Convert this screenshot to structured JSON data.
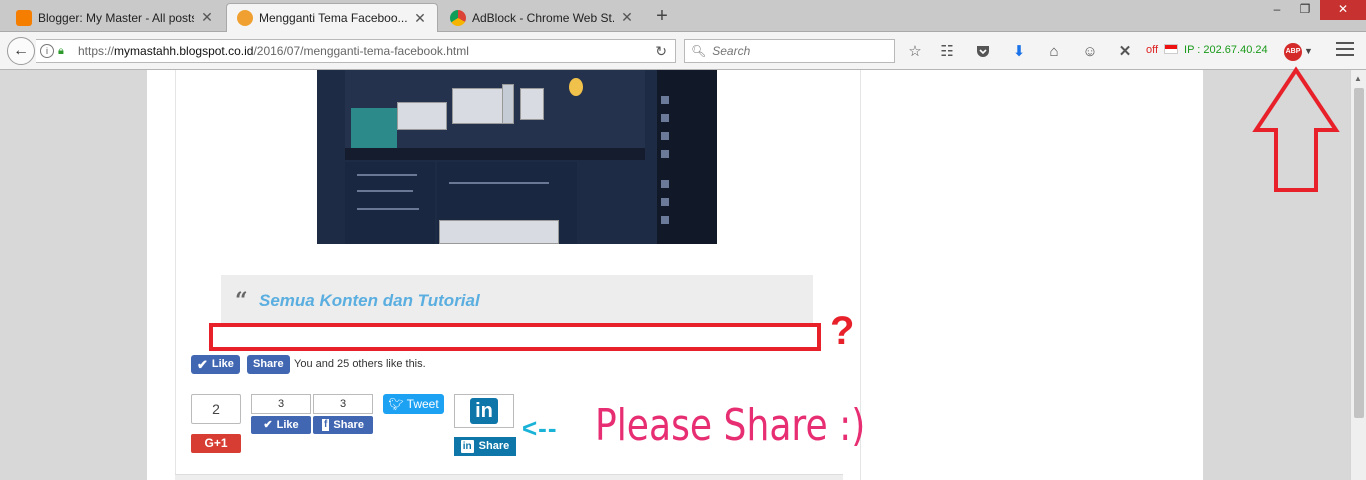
{
  "tabs": [
    {
      "title": "Blogger: My Master - All posts",
      "favicon_color": "#f57d00",
      "active": false
    },
    {
      "title": "Mengganti Tema Faceboo...",
      "favicon_color": "#f0a030",
      "active": true
    },
    {
      "title": "AdBlock - Chrome Web St...",
      "favicon_color": "#4285f4",
      "active": false
    }
  ],
  "tab_close_glyph": "✕",
  "newtab_glyph": "+",
  "window_controls": {
    "minimize": "–",
    "restore": "❐",
    "close": "✕"
  },
  "navbar": {
    "back_glyph": "←",
    "url_prefix": "https://",
    "url_host": "mymastahh.blogspot.co.id",
    "url_path": "/2016/07/mengganti-tema-facebook.html",
    "search_placeholder": "Search",
    "proxy_status": "off",
    "ip_text": "IP : 202.67.40.24",
    "abp_label": "ABP"
  },
  "toolbar_icons": [
    "star-icon",
    "reading-list-icon",
    "pocket-icon",
    "download-icon",
    "home-icon",
    "emoji-icon",
    "x-icon"
  ],
  "post": {
    "quote_text": "Semua Konten dan Tutorial",
    "question_mark": "?",
    "fb_like_label": "Like",
    "fb_share_label": "Share",
    "fb_like_text": "You and 25 others like this.",
    "gplus_count": "2",
    "gplus_label": "G+1",
    "fb_like_count": "3",
    "fb_like_btn": "Like",
    "fb_share_count": "3",
    "fb_share_btn": "Share",
    "tweet_label": "Tweet",
    "linkedin_logo": "in",
    "linkedin_share": "Share",
    "arrow_text": "<--",
    "please_share": "Please Share :)"
  },
  "colors": {
    "annotation_red": "#e8202a",
    "please_share_pink": "#e82e72",
    "arrow_blue": "#19b3d8",
    "facebook_blue": "#4267b2",
    "linkedin_blue": "#0e76a8",
    "twitter_blue": "#1da1f2",
    "gplus_red": "#d73d32"
  }
}
